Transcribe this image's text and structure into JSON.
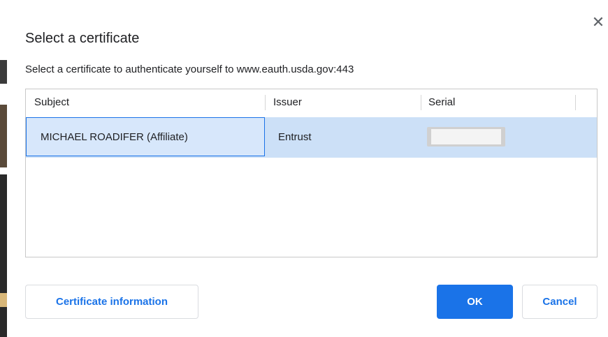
{
  "dialog": {
    "title": "Select a certificate",
    "subtitle": "Select a certificate to authenticate yourself to www.eauth.usda.gov:443",
    "close_icon": "close-icon"
  },
  "table": {
    "columns": [
      "Subject",
      "Issuer",
      "Serial"
    ],
    "rows": [
      {
        "subject": "MICHAEL ROADIFER (Affiliate)",
        "issuer": "Entrust",
        "serial": ""
      }
    ]
  },
  "buttons": {
    "certificate_information": "Certificate information",
    "ok": "OK",
    "cancel": "Cancel"
  },
  "colors": {
    "accent": "#1a73e8",
    "selection": "#cce0f7"
  }
}
